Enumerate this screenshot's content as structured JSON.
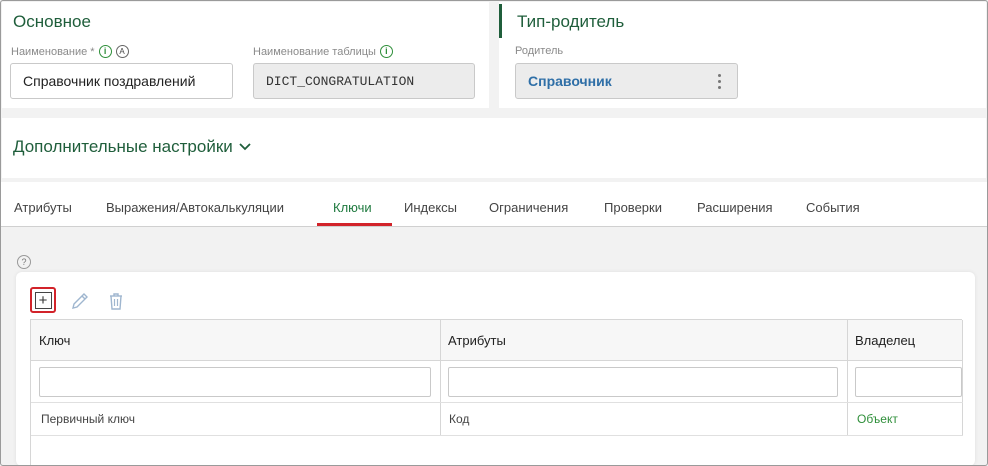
{
  "main_section": {
    "title": "Основное",
    "name_label": "Наименование *",
    "name_value": "Справочник поздравлений",
    "table_label": "Наименование таблицы",
    "table_value": "DICT_CONGRATULATION"
  },
  "parent_section": {
    "title": "Тип-родитель",
    "parent_label": "Родитель",
    "parent_value": "Справочник"
  },
  "extra_settings": {
    "title": "Дополнительные настройки"
  },
  "tabs": [
    {
      "label": "Атрибуты"
    },
    {
      "label": "Выражения/Автокалькуляции"
    },
    {
      "label": "Ключи"
    },
    {
      "label": "Индексы"
    },
    {
      "label": "Ограничения"
    },
    {
      "label": "Проверки"
    },
    {
      "label": "Расширения"
    },
    {
      "label": "События"
    }
  ],
  "active_tab": "Ключи",
  "toolbar": {
    "add_icon": "plus-square-icon",
    "edit_icon": "pencil-icon",
    "delete_icon": "trash-icon"
  },
  "table": {
    "columns": [
      "Ключ",
      "Атрибуты",
      "Владелец"
    ],
    "rows": [
      {
        "key": "Первичный ключ",
        "attributes": "Код",
        "owner": "Объект"
      }
    ]
  },
  "colors": {
    "accent_green": "#1f5e3b",
    "link_blue": "#2f6fa7",
    "highlight_red": "#d2232a"
  }
}
